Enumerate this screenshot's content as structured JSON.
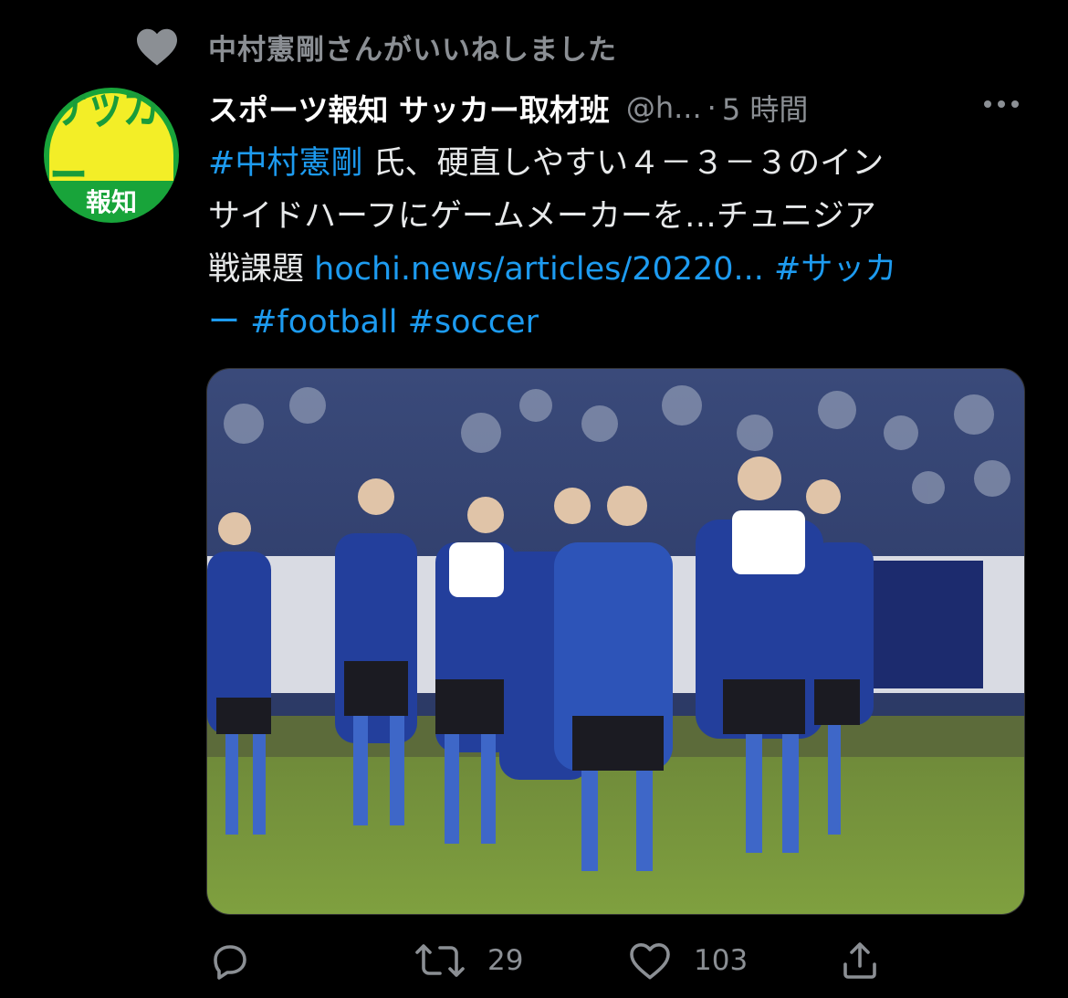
{
  "social_context": {
    "icon": "heart-icon",
    "text": "中村憲剛さんがいいねしました"
  },
  "avatar": {
    "logo_top": "サッカー",
    "logo_bottom": "報知",
    "colors": {
      "outer": "#18a43a",
      "inner": "#f3ee27"
    }
  },
  "tweet": {
    "author_name": "スポーツ報知 サッカー取材班",
    "handle": "@h...",
    "separator": "·",
    "time": "5 時間",
    "more_icon": "more-icon",
    "text": {
      "hashtag_kengo": "#中村憲剛",
      "line1_rest": " 氏、硬直しやすい４－３－３のイン",
      "line2": "サイドハーフにゲームメーカーを…チュニジア",
      "line3_start": "戦課題 ",
      "url": "hochi.news/articles/20220...",
      "hashtag_soccer_a": " #サッカ",
      "hashtag_soccer_b": "ー",
      "hashtag_football": " #football",
      "hashtag_soccer_en": " #soccer"
    },
    "link_color": "#1d9bf0"
  },
  "actions": {
    "reply_icon": "reply-icon",
    "retweet_icon": "retweet-icon",
    "retweet_count": "29",
    "like_icon": "heart-outline-icon",
    "like_count": "103",
    "share_icon": "share-icon"
  }
}
